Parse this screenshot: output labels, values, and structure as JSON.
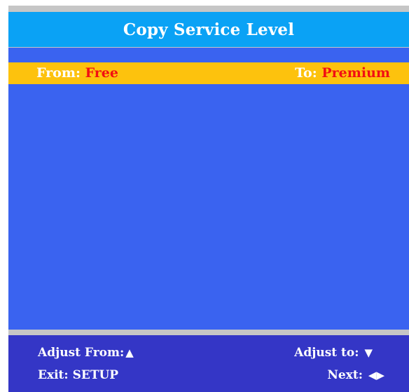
{
  "title": "Copy Service Level",
  "levels": {
    "from_label": "From:",
    "from_value": "Free",
    "to_label": "To:",
    "to_value": "Premium"
  },
  "hints": {
    "adjust_from_label": "Adjust From:",
    "adjust_from_icon": "▲",
    "adjust_to_label": "Adjust to:",
    "adjust_to_icon": "▼",
    "exit_label": "Exit: SETUP",
    "next_label": "Next:",
    "next_icon": "◀▶"
  },
  "colors": {
    "title_bar": "#0aa2f5",
    "main_panel": "#3a63f0",
    "highlight_row": "#fdc20d",
    "value_text": "#f20f12",
    "footer": "#3436c6",
    "border": "#c6c6c6"
  }
}
